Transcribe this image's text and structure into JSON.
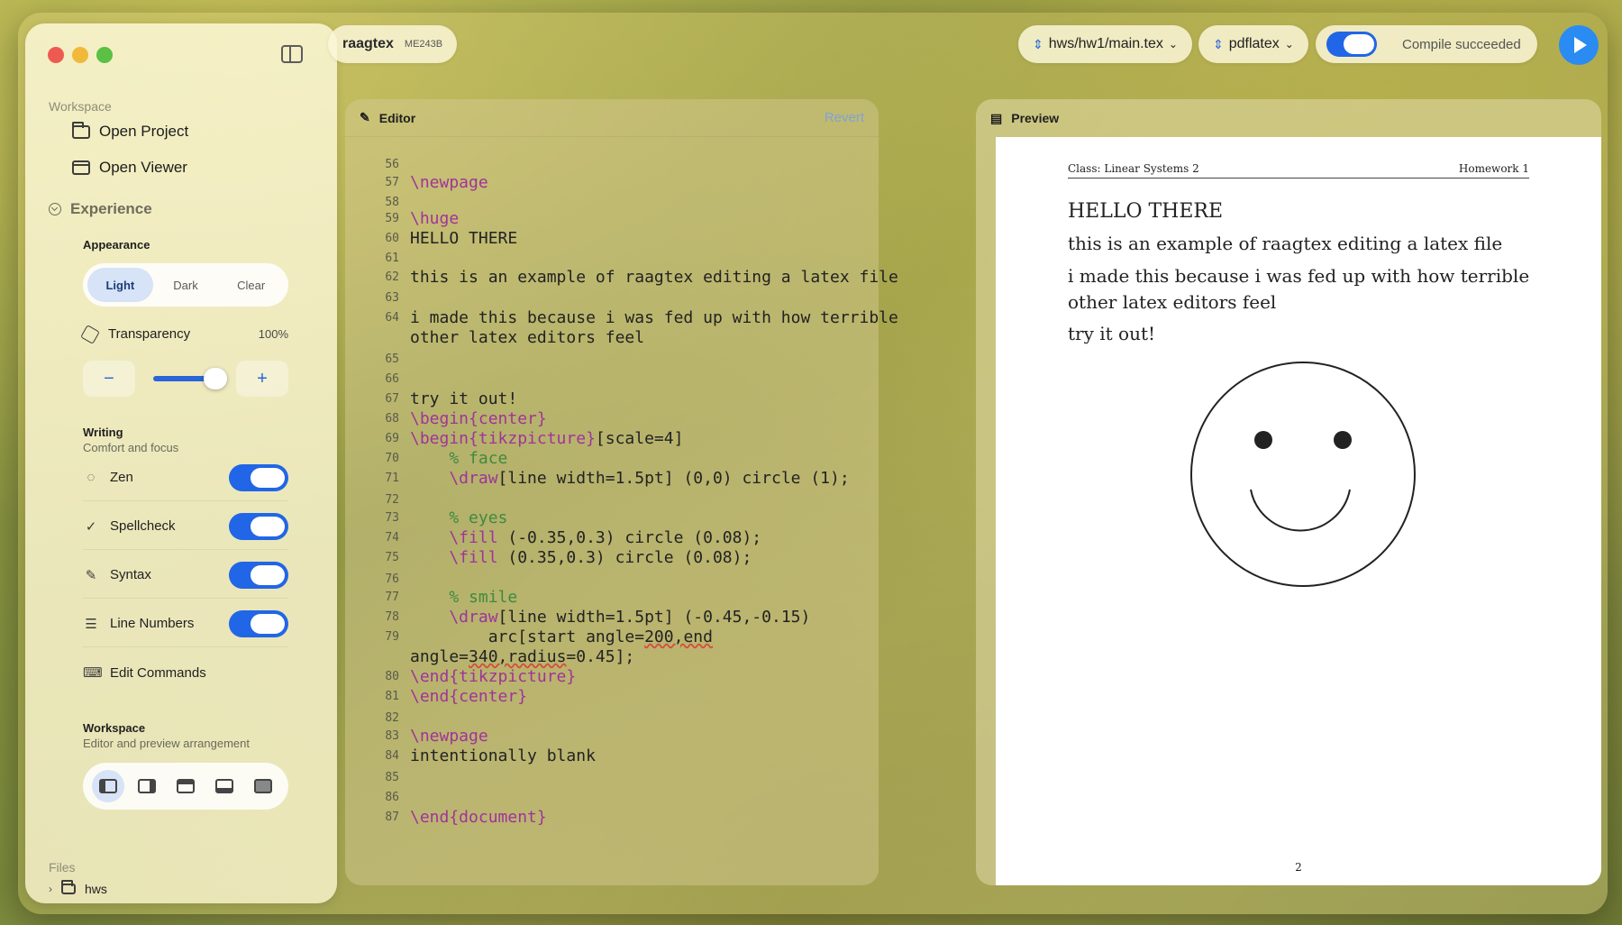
{
  "sidebar": {
    "workspace_title": "Workspace",
    "open_project": "Open Project",
    "open_viewer": "Open Viewer",
    "experience": "Experience",
    "appearance": {
      "label": "Appearance",
      "options": [
        "Light",
        "Dark",
        "Clear"
      ],
      "selected": "Light"
    },
    "transparency": {
      "label": "Transparency",
      "value": "100%",
      "minus": "−",
      "plus": "+"
    },
    "writing": {
      "title": "Writing",
      "subtitle": "Comfort and focus",
      "toggles": [
        {
          "label": "Zen",
          "on": true
        },
        {
          "label": "Spellcheck",
          "on": true
        },
        {
          "label": "Syntax",
          "on": true
        },
        {
          "label": "Line Numbers",
          "on": true
        }
      ],
      "edit_commands": "Edit Commands"
    },
    "workspace_layout": {
      "title": "Workspace",
      "subtitle": "Editor and preview arrangement"
    },
    "files": {
      "title": "Files",
      "items": [
        "hws"
      ]
    }
  },
  "toolbar": {
    "project_name": "raagtex",
    "project_code": "ME243B",
    "file_select": "hws/hw1/main.tex",
    "engine_select": "pdflatex",
    "compile_status": "Compile succeeded"
  },
  "editor": {
    "title": "Editor",
    "revert": "Revert",
    "line_numbers": [
      "56",
      "57",
      "58",
      "59",
      "60",
      "61",
      "62",
      "63",
      "64",
      "65",
      "66",
      "67",
      "68",
      "69",
      "70",
      "71",
      "72",
      "73",
      "74",
      "75",
      "76",
      "77",
      "78",
      "79",
      "80",
      "81",
      "82",
      "83",
      "84",
      "85",
      "86",
      "87"
    ],
    "lines": {
      "l57": "\\newpage",
      "l59": "\\huge",
      "l60": "HELLO THERE",
      "l62": "this is an example of raagtex editing a latex file",
      "l64a": "i made this because i was fed up with how terrible",
      "l64b": "other latex editors feel",
      "l67": "try it out!",
      "l68": "\\begin{center}",
      "l69kw": "\\begin{tikzpicture}",
      "l69rest": "[scale=4]",
      "l70": "    % face",
      "l71kw": "    \\draw",
      "l71rest": "[line width=1.5pt] (0,0) circle (1);",
      "l73": "    % eyes",
      "l74kw": "    \\fill",
      "l74rest": " (-0.35,0.3) circle (0.08);",
      "l75kw": "    \\fill",
      "l75rest": " (0.35,0.3) circle (0.08);",
      "l77": "    % smile",
      "l78kw": "    \\draw",
      "l78rest": "[line width=1.5pt] (-0.45,-0.15)",
      "l79a": "        arc[start angle=",
      "l79b": "200,end",
      "l79c": "angle=",
      "l79d": "340,radius",
      "l79e": "=0.45];",
      "l80": "\\end{tikzpicture}",
      "l81": "\\end{center}",
      "l83": "\\newpage",
      "l84": "intentionally blank",
      "l87": "\\end{document}"
    }
  },
  "preview": {
    "title": "Preview",
    "header_left": "Class: Linear Systems 2",
    "header_right": "Homework 1",
    "heading": "HELLO THERE",
    "para1": "this is an example of raagtex editing a latex file",
    "para2": "i made this because i was fed up with how terrible other latex editors feel",
    "para3": "try it out!",
    "page_number": "2"
  },
  "colors": {
    "accent": "#2166e6",
    "keyword": "#a13399",
    "comment": "#3f8a3f"
  }
}
